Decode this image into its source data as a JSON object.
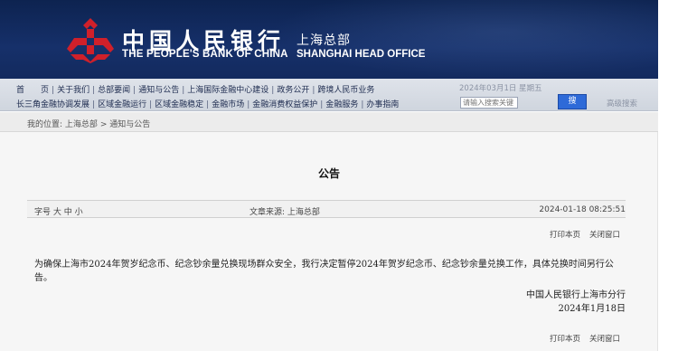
{
  "header": {
    "bank_name_cn": "中国人民银行",
    "bank_name_en": "THE PEOPLE'S BANK OF CHINA",
    "branch_cn": "上海总部",
    "branch_en": "SHANGHAI HEAD OFFICE",
    "logo_icon": "pboc-logo-icon",
    "banner_color": "#16306a",
    "logo_color": "#d0202a"
  },
  "nav": {
    "row1": [
      "首　　页",
      "关于我们",
      "总部要闻",
      "通知与公告",
      "上海国际金融中心建设",
      "政务公开",
      "跨境人民币业务"
    ],
    "row2": [
      "长三角金融协调发展",
      "区域金融运行",
      "区域金融稳定",
      "金融市场",
      "金融消费权益保护",
      "金融服务",
      "办事指南"
    ],
    "date": "2024年03月1日 星期五",
    "search_placeholder": "请输入搜索关键",
    "search_button": "搜",
    "search_icon": "search-icon",
    "advanced_search": "高级搜索"
  },
  "breadcrumb": {
    "label": "我的位置:",
    "path": [
      "上海总部",
      "通知与公告"
    ],
    "separator": ">"
  },
  "article": {
    "title": "公告",
    "font_size_label": "字号",
    "font_sizes": [
      "大",
      "中",
      "小"
    ],
    "source_label": "文章来源:",
    "source": "上海总部",
    "publish_time": "2024-01-18 08:25:51",
    "body": "为确保上海市2024年贺岁纪念币、纪念钞余量兑换现场群众安全，我行决定暂停2024年贺岁纪念币、纪念钞余量兑换工作，具体兑换时间另行公告。",
    "signature_org": "中国人民银行上海市分行",
    "signature_date": "2024年1月18日",
    "print_label": "打印本页",
    "close_label": "关闭窗口"
  }
}
